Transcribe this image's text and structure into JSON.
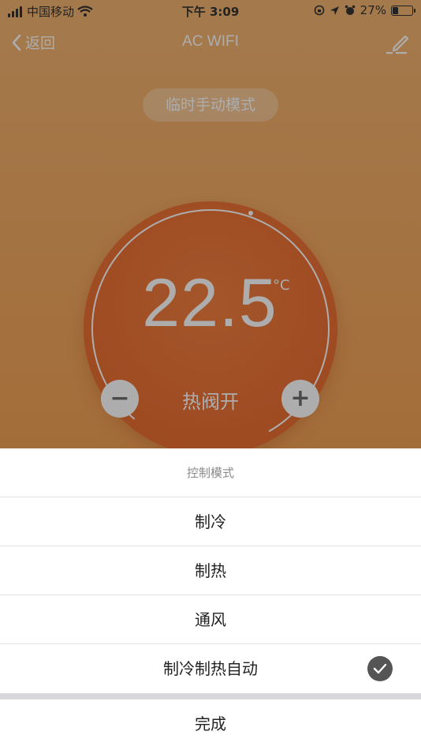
{
  "status_bar": {
    "carrier": "中国移动",
    "time": "下午 3:09",
    "battery_percent": "27%",
    "battery_level": 0.27,
    "icons": [
      "signal-icon",
      "wifi-icon",
      "screen-lock-icon",
      "location-icon",
      "alarm-icon",
      "battery-icon"
    ]
  },
  "nav": {
    "back_label": "返回",
    "title": "AC WIFI",
    "edit_icon": "edit-icon"
  },
  "mode_pill": "临时手动模式",
  "thermostat": {
    "temperature": "22.5",
    "unit": "°C",
    "state": "热阀开",
    "minus_label": "−",
    "plus_label": "+"
  },
  "sheet": {
    "title": "控制模式",
    "options": [
      {
        "label": "制冷",
        "selected": false
      },
      {
        "label": "制热",
        "selected": false
      },
      {
        "label": "通风",
        "selected": false
      },
      {
        "label": "制冷制热自动",
        "selected": true
      }
    ],
    "done_label": "完成"
  },
  "colors": {
    "background_top": "#f0a75a",
    "dial": "#e85812",
    "check": "#555555"
  }
}
